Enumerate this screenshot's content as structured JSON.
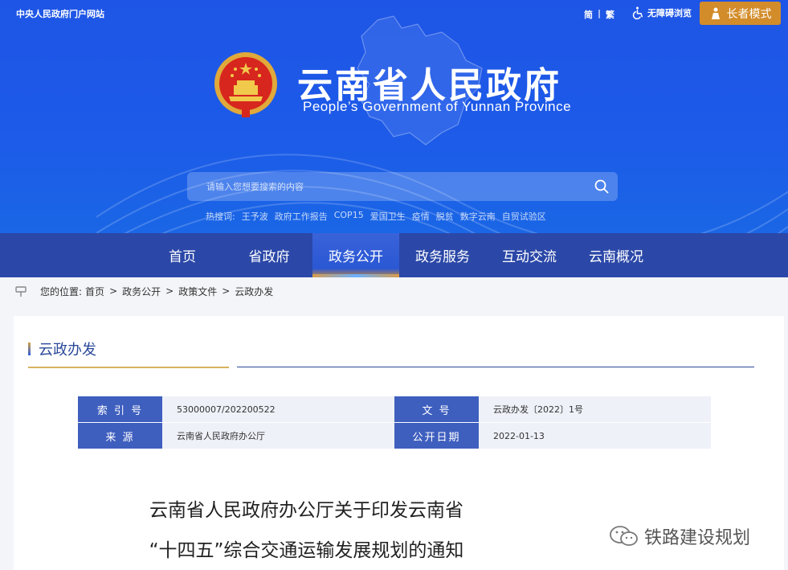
{
  "topbar": {
    "portal_link": "中央人民政府门户网站",
    "lang_simplified": "简",
    "lang_sep": "|",
    "lang_traditional": "繁",
    "accessibility": "无障碍浏览",
    "elder_mode": "长者模式"
  },
  "brand": {
    "title": "云南省人民政府",
    "subtitle": "People’s Government of Yunnan Province"
  },
  "search": {
    "placeholder": "请输入您想要搜索的内容"
  },
  "hot": {
    "label": "热搜词:",
    "terms": [
      "王予波",
      "政府工作报告",
      "COP15",
      "爱国卫生",
      "疫情",
      "脱贫",
      "数字云南",
      "自贸试验区"
    ]
  },
  "nav": {
    "items": [
      "首页",
      "省政府",
      "政务公开",
      "政务服务",
      "互动交流",
      "云南概况"
    ],
    "active_index": 2
  },
  "breadcrumb": {
    "prefix": "您的位置:",
    "items": [
      "首页",
      "政务公开",
      "政策文件",
      "云政办发"
    ],
    "arrow": ">"
  },
  "section": {
    "title": "云政办发"
  },
  "meta": {
    "index_label": "索 引 号",
    "index_value": "53000007/202200522",
    "docno_label": "文 号",
    "docno_value": "云政办发〔2022〕1号",
    "source_label": "来 源",
    "source_value": "云南省人民政府办公厅",
    "date_label": "公开日期",
    "date_value": "2022-01-13"
  },
  "document": {
    "title_line1": "云南省人民政府办公厅关于印发云南省",
    "title_line2": "“十四五”综合交通运输发展规划的通知"
  },
  "watermark": {
    "text": "铁路建设规划"
  },
  "colors": {
    "header_blue": "#1e55e6",
    "nav_blue": "#2b48a8",
    "elder_orange": "#d38c2a",
    "label_blue": "#3f5fbf"
  }
}
